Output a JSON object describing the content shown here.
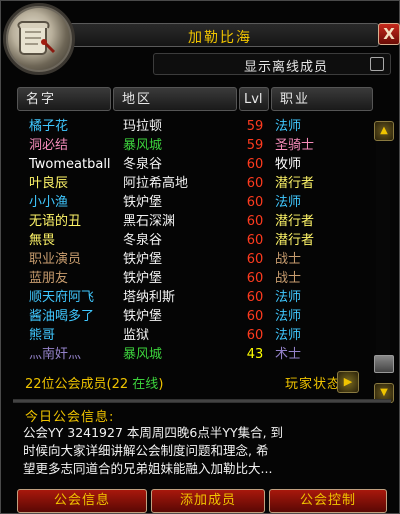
{
  "window": {
    "title": "加勒比海",
    "close_label": "X"
  },
  "options": {
    "show_offline_label": "显示离线成员",
    "show_offline_checked": false
  },
  "columns": {
    "name": "名字",
    "zone": "地区",
    "level": "Lvl",
    "class": "职业"
  },
  "members": [
    {
      "name": "橘子花",
      "zone": "玛拉顿",
      "level": "59",
      "class": "法师",
      "name_color": "#40c8ff",
      "class_color": "#40c8ff",
      "level_color": "#ff3b1f"
    },
    {
      "name": "洞必结",
      "zone": "暴风城",
      "level": "59",
      "class": "圣骑士",
      "name_color": "#f58cba",
      "class_color": "#f58cba",
      "level_color": "#ff3b1f",
      "zone_color": "#3cd23c"
    },
    {
      "name": "Twomeatball",
      "zone": "冬泉谷",
      "level": "60",
      "class": "牧师",
      "name_color": "#ffffff",
      "class_color": "#ffffff",
      "level_color": "#ff3b1f"
    },
    {
      "name": "叶良辰",
      "zone": "阿拉希高地",
      "level": "60",
      "class": "潜行者",
      "name_color": "#fff569",
      "class_color": "#fff569",
      "level_color": "#ff3b1f"
    },
    {
      "name": "小小渔",
      "zone": "铁炉堡",
      "level": "60",
      "class": "法师",
      "name_color": "#40c8ff",
      "class_color": "#40c8ff",
      "level_color": "#ff3b1f"
    },
    {
      "name": "无语的丑",
      "zone": "黑石深渊",
      "level": "60",
      "class": "潜行者",
      "name_color": "#fff569",
      "class_color": "#fff569",
      "level_color": "#ff3b1f"
    },
    {
      "name": "無畏",
      "zone": "冬泉谷",
      "level": "60",
      "class": "潜行者",
      "name_color": "#fff569",
      "class_color": "#fff569",
      "level_color": "#ff3b1f"
    },
    {
      "name": "职业演员",
      "zone": "铁炉堡",
      "level": "60",
      "class": "战士",
      "name_color": "#c79c6e",
      "class_color": "#c79c6e",
      "level_color": "#ff3b1f"
    },
    {
      "name": "蓝朋友",
      "zone": "铁炉堡",
      "level": "60",
      "class": "战士",
      "name_color": "#c79c6e",
      "class_color": "#c79c6e",
      "level_color": "#ff3b1f"
    },
    {
      "name": "顺天府阿飞",
      "zone": "塔纳利斯",
      "level": "60",
      "class": "法师",
      "name_color": "#40c8ff",
      "class_color": "#40c8ff",
      "level_color": "#ff3b1f"
    },
    {
      "name": "酱油喝多了",
      "zone": "铁炉堡",
      "level": "60",
      "class": "法师",
      "name_color": "#40c8ff",
      "class_color": "#40c8ff",
      "level_color": "#ff3b1f"
    },
    {
      "name": "熊哥",
      "zone": "监狱",
      "level": "60",
      "class": "法师",
      "name_color": "#40c8ff",
      "class_color": "#40c8ff",
      "level_color": "#ff3b1f"
    },
    {
      "name": "灬南奸灬",
      "zone": "暴风城",
      "level": "43",
      "class": "术士",
      "name_color": "#9482c9",
      "class_color": "#9482c9",
      "level_color": "#ffff00",
      "zone_color": "#3cd23c"
    }
  ],
  "summary": {
    "count_text": "22位公会成员(22 ",
    "online_text": "在线",
    "close_paren": ")"
  },
  "player_status_label": "玩家状态",
  "status_button_glyph": "▶",
  "motd": {
    "title": "今日公会信息:",
    "lines": [
      "公会YY 3241927 本周周四晚6点半YY集合, 到",
      "时候向大家详细讲解公会制度问题和理念, 希",
      "望更多志同道合的兄弟姐妹能融入加勒比大..."
    ]
  },
  "buttons": {
    "guild_info": "公会信息",
    "add_member": "添加成员",
    "guild_control": "公会控制"
  },
  "colors": {
    "gold": "#f0c400",
    "online_green": "#3cd23c",
    "level_red": "#ff3b1f"
  }
}
